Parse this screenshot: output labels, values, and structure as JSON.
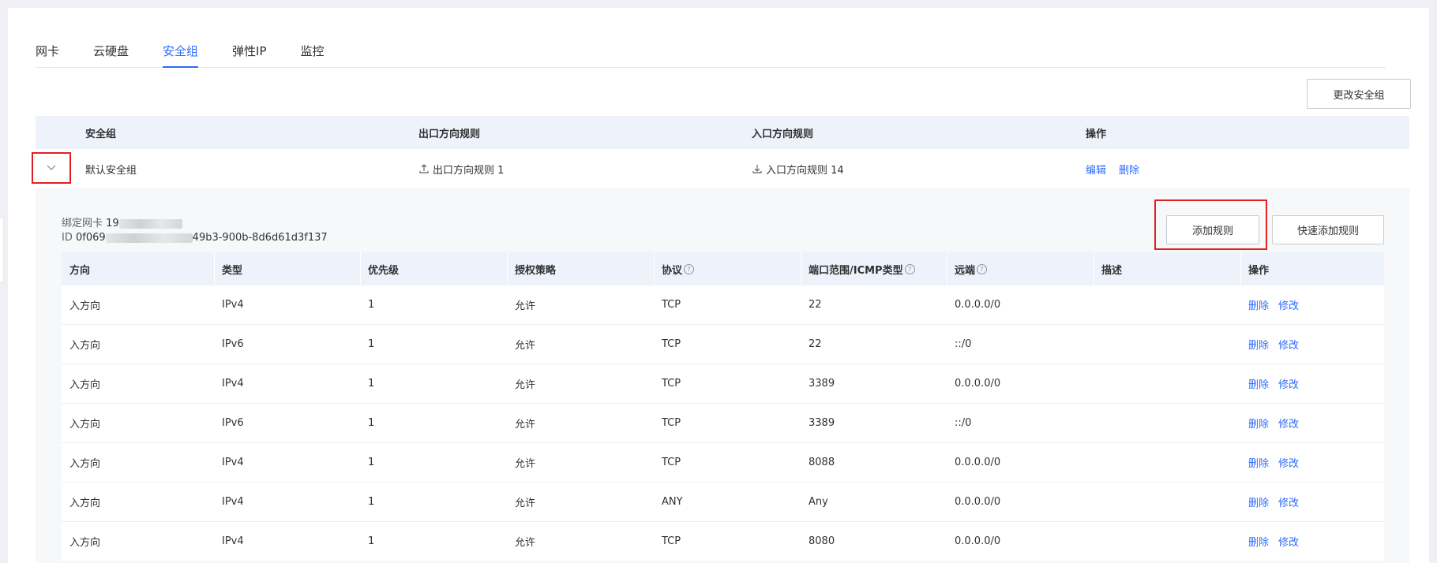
{
  "tabs": [
    "网卡",
    "云硬盘",
    "安全组",
    "弹性IP",
    "监控"
  ],
  "active_tab": 2,
  "change_sg_button": "更改安全组",
  "sg_table": {
    "headers": [
      "安全组",
      "出口方向规则",
      "入口方向规则",
      "操作"
    ],
    "row": {
      "name": "默认安全组",
      "outbound": "出口方向规则 1",
      "inbound": "入口方向规则 14",
      "edit": "编辑",
      "delete": "删除"
    }
  },
  "detail": {
    "bind_nic_label": "绑定网卡",
    "bind_nic_value": "19",
    "id_label": "ID",
    "id_prefix": "0f069",
    "id_suffix": "49b3-900b-8d6d61d3f137",
    "add_rule_button": "添加规则",
    "quick_add_button": "快速添加规则"
  },
  "rules_table": {
    "headers": [
      "方向",
      "类型",
      "优先级",
      "授权策略",
      "协议",
      "端口范围/ICMP类型",
      "远端",
      "描述",
      "操作"
    ],
    "delete_label": "删除",
    "modify_label": "修改",
    "rows": [
      [
        "入方向",
        "IPv4",
        "1",
        "允许",
        "TCP",
        "22",
        "0.0.0.0/0",
        ""
      ],
      [
        "入方向",
        "IPv6",
        "1",
        "允许",
        "TCP",
        "22",
        "::/0",
        ""
      ],
      [
        "入方向",
        "IPv4",
        "1",
        "允许",
        "TCP",
        "3389",
        "0.0.0.0/0",
        ""
      ],
      [
        "入方向",
        "IPv6",
        "1",
        "允许",
        "TCP",
        "3389",
        "::/0",
        ""
      ],
      [
        "入方向",
        "IPv4",
        "1",
        "允许",
        "TCP",
        "8088",
        "0.0.0.0/0",
        ""
      ],
      [
        "入方向",
        "IPv4",
        "1",
        "允许",
        "ANY",
        "Any",
        "0.0.0.0/0",
        ""
      ],
      [
        "入方向",
        "IPv4",
        "1",
        "允许",
        "TCP",
        "8080",
        "0.0.0.0/0",
        ""
      ]
    ]
  },
  "colors": {
    "accent": "#2c6bff",
    "highlight": "#e02020",
    "header_bg": "#eef2fb"
  }
}
